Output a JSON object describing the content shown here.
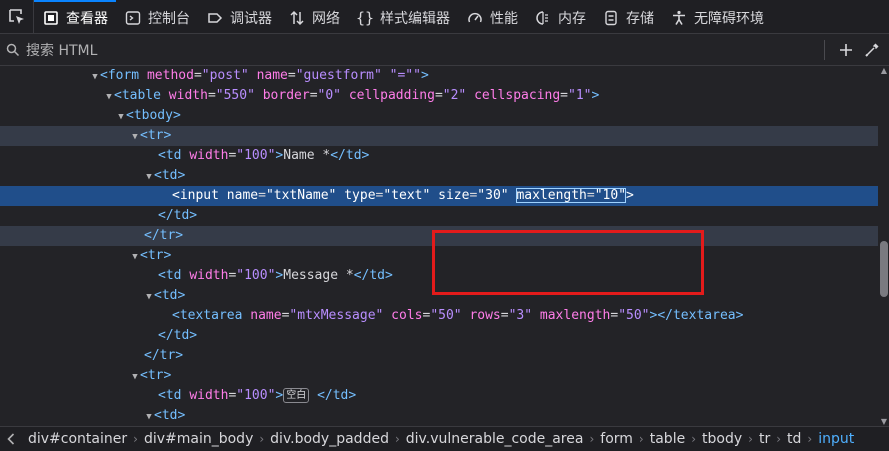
{
  "toolbar": {
    "tabs": [
      {
        "label": "查看器",
        "icon": "inspector-icon",
        "active": true
      },
      {
        "label": "控制台",
        "icon": "console-icon"
      },
      {
        "label": "调试器",
        "icon": "debugger-icon"
      },
      {
        "label": "网络",
        "icon": "network-icon"
      },
      {
        "label": "样式编辑器",
        "icon": "style-editor-icon"
      },
      {
        "label": "性能",
        "icon": "performance-icon"
      },
      {
        "label": "内存",
        "icon": "memory-icon"
      },
      {
        "label": "存储",
        "icon": "storage-icon"
      },
      {
        "label": "无障碍环境",
        "icon": "accessibility-icon"
      }
    ]
  },
  "search": {
    "placeholder": "搜索 HTML"
  },
  "tree": {
    "form_tag": "<form",
    "form_a1n": "method",
    "form_a1v": "\"post\"",
    "form_a2n": "name",
    "form_a2v": "\"guestform\"",
    "form_a3": "\"=\"\"",
    "form_close": ">",
    "table_open": "<table",
    "table_a1n": "width",
    "table_a1v": "\"550\"",
    "table_a2n": "border",
    "table_a2v": "\"0\"",
    "table_a3n": "cellpadding",
    "table_a3v": "\"2\"",
    "table_a4n": "cellspacing",
    "table_a4v": "\"1\"",
    "tbody": "<tbody>",
    "tr_open": "<tr>",
    "tr_close": "</tr>",
    "td_open": "<td>",
    "td_close": "</td>",
    "td_w_open": "<td",
    "td_w_n": "width",
    "td_w_v": "\"100\"",
    "name_text": "Name *",
    "message_text": "Message *",
    "input_open": "<input",
    "input_a1n": "name",
    "input_a1v": "\"txtName\"",
    "input_a2n": "type",
    "input_a2v": "\"text\"",
    "input_a3n": "size",
    "input_a3v": "\"30\"",
    "input_a4n": "maxlength",
    "input_a4v": "\"10\"",
    "textarea_open": "<textarea",
    "ta_a1n": "name",
    "ta_a1v": "\"mtxMessage\"",
    "ta_a2n": "cols",
    "ta_a2v": "\"50\"",
    "ta_a3n": "rows",
    "ta_a3v": "\"3\"",
    "ta_a4n": "maxlength",
    "ta_a4v": "\"50\"",
    "textarea_close": "></textarea>",
    "space_badge": "空白"
  },
  "breadcrumbs": [
    "div#container",
    "div#main_body",
    "div.body_padded",
    "div.vulnerable_code_area",
    "form",
    "table",
    "tbody",
    "tr",
    "td",
    "input"
  ]
}
